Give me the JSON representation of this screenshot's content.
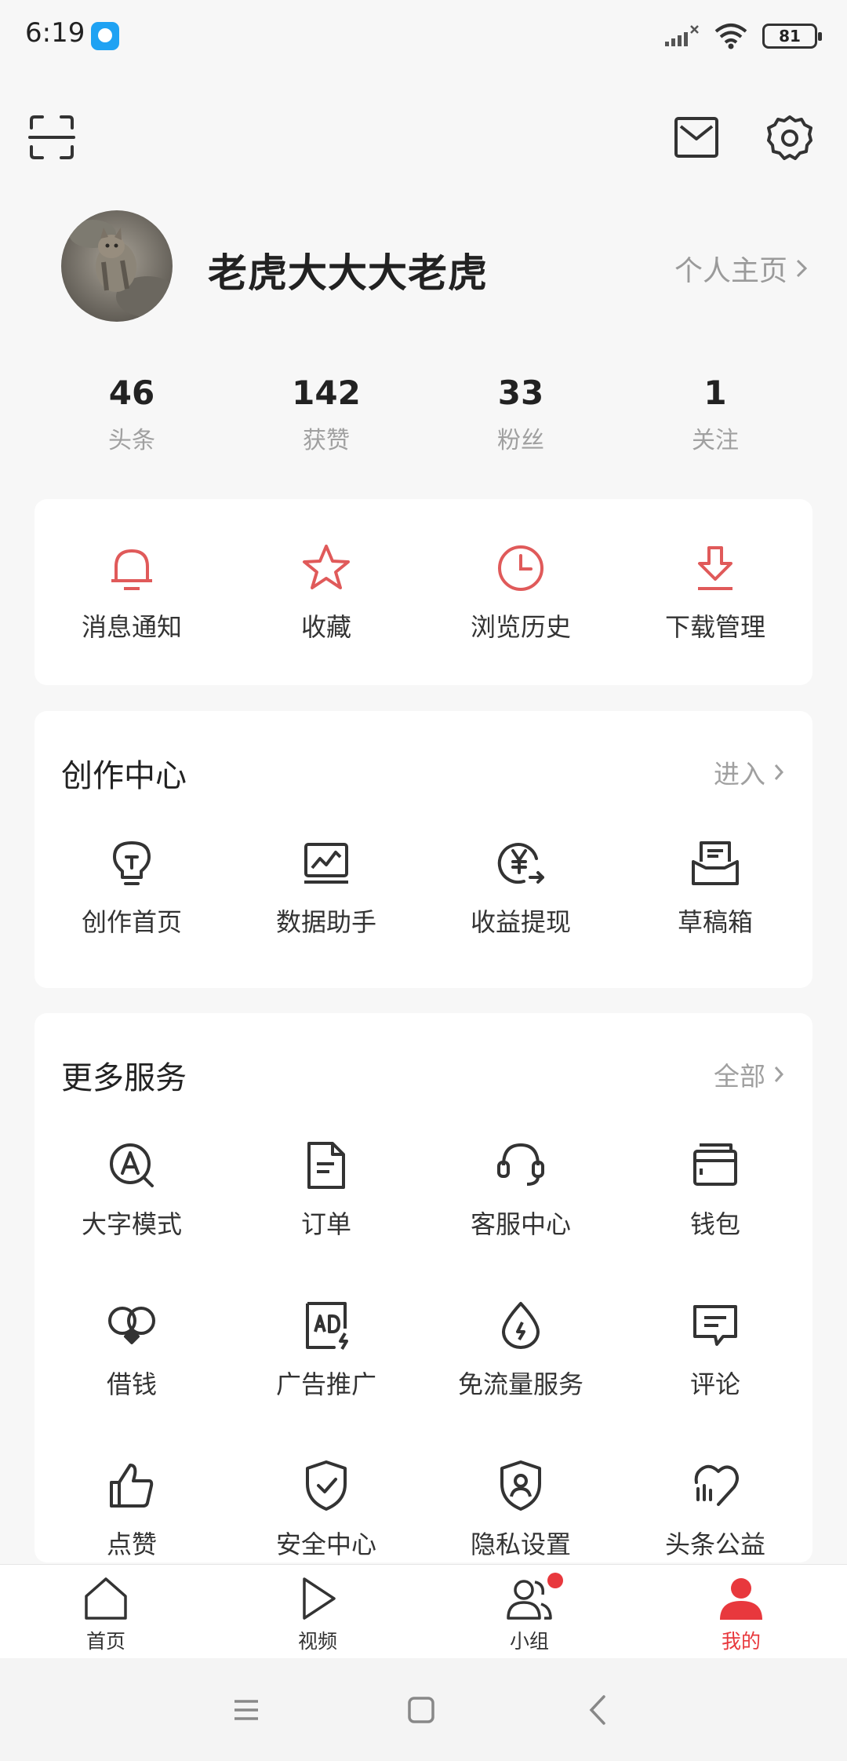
{
  "status_bar": {
    "time": "6:19",
    "battery": "81",
    "app_icon": "message-bubble-icon"
  },
  "top_bar": {
    "scan_icon": "scan-icon",
    "mail_icon": "mail-icon",
    "settings_icon": "gear-icon"
  },
  "profile": {
    "username": "老虎大大大老虎",
    "home_link": "个人主页"
  },
  "stats": [
    {
      "value": "46",
      "label": "头条"
    },
    {
      "value": "142",
      "label": "获赞"
    },
    {
      "value": "33",
      "label": "粉丝"
    },
    {
      "value": "1",
      "label": "关注"
    }
  ],
  "quick_actions": [
    {
      "label": "消息通知",
      "icon": "bell-icon"
    },
    {
      "label": "收藏",
      "icon": "star-icon"
    },
    {
      "label": "浏览历史",
      "icon": "clock-icon"
    },
    {
      "label": "下载管理",
      "icon": "download-icon"
    }
  ],
  "creation_center": {
    "title": "创作中心",
    "link": "进入",
    "items": [
      {
        "label": "创作首页",
        "icon": "lightbulb-icon"
      },
      {
        "label": "数据助手",
        "icon": "chart-monitor-icon"
      },
      {
        "label": "收益提现",
        "icon": "yuan-withdraw-icon"
      },
      {
        "label": "草稿箱",
        "icon": "draft-box-icon"
      }
    ]
  },
  "more_services": {
    "title": "更多服务",
    "link": "全部",
    "items": [
      {
        "label": "大字模式",
        "icon": "large-font-icon"
      },
      {
        "label": "订单",
        "icon": "order-document-icon"
      },
      {
        "label": "客服中心",
        "icon": "headset-icon"
      },
      {
        "label": "钱包",
        "icon": "wallet-icon"
      },
      {
        "label": "借钱",
        "icon": "loan-icon"
      },
      {
        "label": "广告推广",
        "icon": "ad-icon"
      },
      {
        "label": "免流量服务",
        "icon": "data-drop-icon"
      },
      {
        "label": "评论",
        "icon": "comment-icon"
      },
      {
        "label": "点赞",
        "icon": "thumbs-up-icon"
      },
      {
        "label": "安全中心",
        "icon": "shield-check-icon"
      },
      {
        "label": "隐私设置",
        "icon": "shield-user-icon"
      },
      {
        "label": "头条公益",
        "icon": "charity-heart-icon"
      }
    ]
  },
  "bottom_nav": [
    {
      "label": "首页",
      "icon": "home-icon"
    },
    {
      "label": "视频",
      "icon": "play-icon"
    },
    {
      "label": "小组",
      "icon": "group-icon",
      "has_badge": true
    },
    {
      "label": "我的",
      "icon": "user-icon",
      "active": true
    }
  ],
  "colors": {
    "accent": "#e8383d",
    "icon_red": "#e05a5a",
    "background": "#f7f7f7"
  }
}
